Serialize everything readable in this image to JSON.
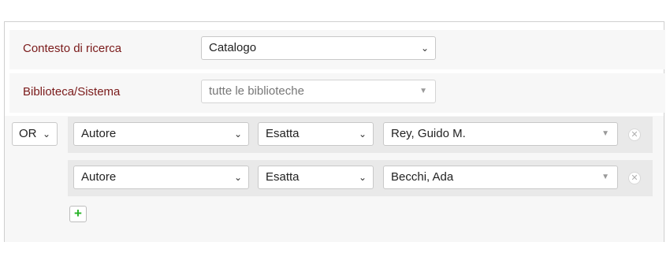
{
  "context": {
    "label": "Contesto di ricerca",
    "value": "Catalogo"
  },
  "library": {
    "label": "Biblioteca/Sistema",
    "value": "tutte le biblioteche"
  },
  "boolean_operator": "OR",
  "criteria": [
    {
      "field": "Autore",
      "match": "Esatta",
      "value": "Rey, Guido M."
    },
    {
      "field": "Autore",
      "match": "Esatta",
      "value": "Becchi, Ada"
    }
  ],
  "icons": {
    "remove": "close-icon",
    "add": "plus-icon",
    "dropdown": "chevron-down-icon"
  },
  "colors": {
    "label": "#7a1a1a",
    "add": "#27b327"
  }
}
